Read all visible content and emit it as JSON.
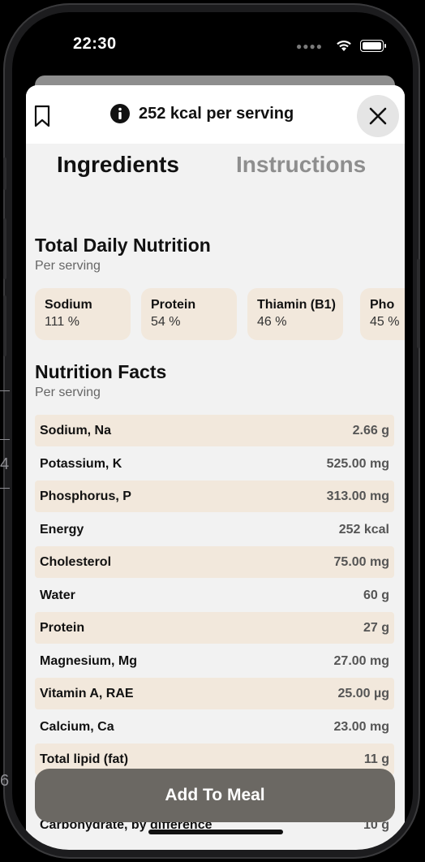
{
  "status": {
    "time": "22:30"
  },
  "header": {
    "kcal_label": "252 kcal per serving"
  },
  "tabs": [
    {
      "label": "Ingredients",
      "active": true
    },
    {
      "label": "Instructions",
      "active": false
    }
  ],
  "daily": {
    "title": "Total Daily Nutrition",
    "subtitle": "Per serving",
    "cards": [
      {
        "name": "Sodium",
        "pct": "111 %"
      },
      {
        "name": "Protein",
        "pct": "54 %"
      },
      {
        "name": "Thiamin (B1)",
        "pct": "46 %"
      },
      {
        "name": "Pho",
        "pct": "45 %"
      }
    ]
  },
  "facts": {
    "title": "Nutrition Facts",
    "subtitle": "Per serving",
    "rows": [
      {
        "name": "Sodium, Na",
        "value": "2.66 g"
      },
      {
        "name": "Potassium, K",
        "value": "525.00 mg"
      },
      {
        "name": "Phosphorus, P",
        "value": "313.00 mg"
      },
      {
        "name": "Energy",
        "value": "252 kcal"
      },
      {
        "name": "Cholesterol",
        "value": "75.00 mg"
      },
      {
        "name": "Water",
        "value": "60 g"
      },
      {
        "name": "Protein",
        "value": "27 g"
      },
      {
        "name": "Magnesium, Mg",
        "value": "27.00 mg"
      },
      {
        "name": "Vitamin A, RAE",
        "value": "25.00 µg"
      },
      {
        "name": "Calcium, Ca",
        "value": "23.00 mg"
      },
      {
        "name": "Total lipid (fat)",
        "value": "11 g"
      },
      {
        "name": "Carbohydrate, by difference",
        "value": "10 g"
      }
    ]
  },
  "add_button": {
    "label": "Add To Meal"
  },
  "colors": {
    "card_bg": "#f2e8dc",
    "button_bg": "#6b6863",
    "sheet_bg": "#f2f2f2"
  },
  "edge_labels": [
    "4",
    "6"
  ]
}
